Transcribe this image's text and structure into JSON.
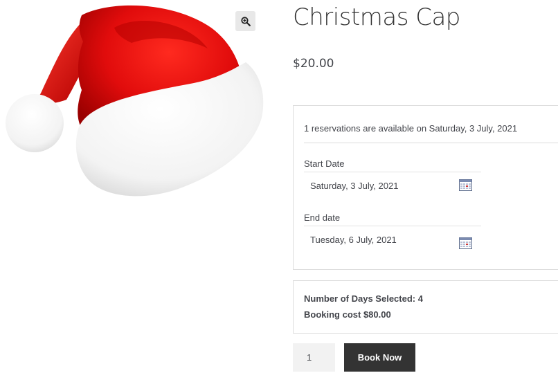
{
  "product": {
    "title": "Christmas Cap",
    "price": "$20.00",
    "image_icon": "santa-hat-image",
    "zoom_icon": "zoom-in-icon"
  },
  "booking": {
    "availability_text": "1 reservations are available on Saturday, 3 July, 2021",
    "start_label": "Start Date",
    "start_value": "Saturday, 3 July, 2021",
    "end_label": "End date",
    "end_value": "Tuesday, 6 July, 2021",
    "calendar_icon": "calendar-icon"
  },
  "summary": {
    "days_selected": "Number of Days Selected: 4",
    "booking_cost": "Booking cost $80.00"
  },
  "cart": {
    "quantity": "1",
    "book_label": "Book Now"
  },
  "colors": {
    "button_bg": "#333333",
    "hat_red": "#d40000",
    "text": "#43454b"
  }
}
